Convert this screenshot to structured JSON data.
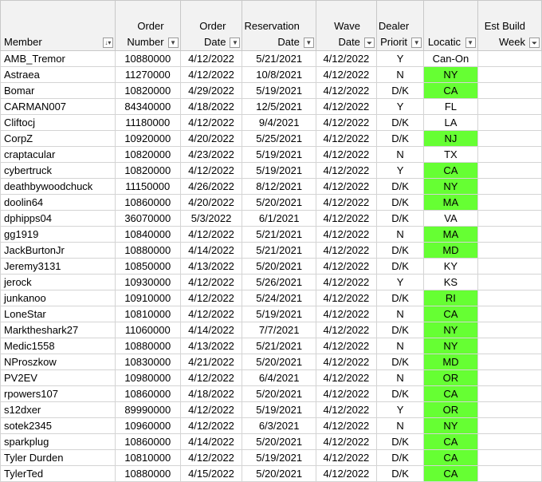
{
  "headers": {
    "member": [
      "Member"
    ],
    "order_number": [
      "Order",
      "Number"
    ],
    "order_date": [
      "Order",
      "Date"
    ],
    "reservation_date": [
      "Reservation",
      "Date"
    ],
    "wave_date": [
      "Wave",
      "Date"
    ],
    "dealer_priority": [
      "Dealer",
      "Priorit"
    ],
    "location": [
      "Locatic"
    ],
    "est_build_week": [
      "Est Build",
      "Week"
    ]
  },
  "filter_icons": {
    "member": "sort-ascending-icon",
    "order_number": "dropdown-arrow-icon",
    "order_date": "dropdown-arrow-icon",
    "reservation_date": "dropdown-arrow-icon",
    "wave_date": "filter-active-icon",
    "dealer_priority": "dropdown-arrow-icon",
    "location": "dropdown-arrow-icon",
    "est_build_week": "filter-active-icon"
  },
  "colors": {
    "location_highlight": "#66ff33",
    "header_bg": "#f2f2f2",
    "gridline": "#d4d4d4"
  },
  "rows": [
    {
      "member": "AMB_Tremor",
      "order_number": "10880000",
      "order_date": "4/12/2022",
      "reservation_date": "5/21/2021",
      "wave_date": "4/12/2022",
      "dealer_priority": "Y",
      "location": "Can-On",
      "highlight": false
    },
    {
      "member": "Astraea",
      "order_number": "11270000",
      "order_date": "4/12/2022",
      "reservation_date": "10/8/2021",
      "wave_date": "4/12/2022",
      "dealer_priority": "N",
      "location": "NY",
      "highlight": true
    },
    {
      "member": "Bomar",
      "order_number": "10820000",
      "order_date": "4/29/2022",
      "reservation_date": "5/19/2021",
      "wave_date": "4/12/2022",
      "dealer_priority": "D/K",
      "location": "CA",
      "highlight": true
    },
    {
      "member": "CARMAN007",
      "order_number": "84340000",
      "order_date": "4/18/2022",
      "reservation_date": "12/5/2021",
      "wave_date": "4/12/2022",
      "dealer_priority": "Y",
      "location": "FL",
      "highlight": false
    },
    {
      "member": "Cliftocj",
      "order_number": "11180000",
      "order_date": "4/12/2022",
      "reservation_date": "9/4/2021",
      "wave_date": "4/12/2022",
      "dealer_priority": "D/K",
      "location": "LA",
      "highlight": false
    },
    {
      "member": "CorpZ",
      "order_number": "10920000",
      "order_date": "4/20/2022",
      "reservation_date": "5/25/2021",
      "wave_date": "4/12/2022",
      "dealer_priority": "D/K",
      "location": "NJ",
      "highlight": true
    },
    {
      "member": "craptacular",
      "order_number": "10820000",
      "order_date": "4/23/2022",
      "reservation_date": "5/19/2021",
      "wave_date": "4/12/2022",
      "dealer_priority": "N",
      "location": "TX",
      "highlight": false
    },
    {
      "member": "cybertruck",
      "order_number": "10820000",
      "order_date": "4/12/2022",
      "reservation_date": "5/19/2021",
      "wave_date": "4/12/2022",
      "dealer_priority": "Y",
      "location": "CA",
      "highlight": true
    },
    {
      "member": "deathbywoodchuck",
      "order_number": "11150000",
      "order_date": "4/26/2022",
      "reservation_date": "8/12/2021",
      "wave_date": "4/12/2022",
      "dealer_priority": "D/K",
      "location": "NY",
      "highlight": true
    },
    {
      "member": "doolin64",
      "order_number": "10860000",
      "order_date": "4/20/2022",
      "reservation_date": "5/20/2021",
      "wave_date": "4/12/2022",
      "dealer_priority": "D/K",
      "location": "MA",
      "highlight": true
    },
    {
      "member": "dphipps04",
      "order_number": "36070000",
      "order_date": "5/3/2022",
      "reservation_date": "6/1/2021",
      "wave_date": "4/12/2022",
      "dealer_priority": "D/K",
      "location": "VA",
      "highlight": false
    },
    {
      "member": "gg1919",
      "order_number": "10840000",
      "order_date": "4/12/2022",
      "reservation_date": "5/21/2021",
      "wave_date": "4/12/2022",
      "dealer_priority": "N",
      "location": "MA",
      "highlight": true
    },
    {
      "member": "JackBurtonJr",
      "order_number": "10880000",
      "order_date": "4/14/2022",
      "reservation_date": "5/21/2021",
      "wave_date": "4/12/2022",
      "dealer_priority": "D/K",
      "location": "MD",
      "highlight": true
    },
    {
      "member": "Jeremy3131",
      "order_number": "10850000",
      "order_date": "4/13/2022",
      "reservation_date": "5/20/2021",
      "wave_date": "4/12/2022",
      "dealer_priority": "D/K",
      "location": "KY",
      "highlight": false
    },
    {
      "member": "jerock",
      "order_number": "10930000",
      "order_date": "4/12/2022",
      "reservation_date": "5/26/2021",
      "wave_date": "4/12/2022",
      "dealer_priority": "Y",
      "location": "KS",
      "highlight": false
    },
    {
      "member": "junkanoo",
      "order_number": "10910000",
      "order_date": "4/12/2022",
      "reservation_date": "5/24/2021",
      "wave_date": "4/12/2022",
      "dealer_priority": "D/K",
      "location": "RI",
      "highlight": true
    },
    {
      "member": "LoneStar",
      "order_number": "10810000",
      "order_date": "4/12/2022",
      "reservation_date": "5/19/2021",
      "wave_date": "4/12/2022",
      "dealer_priority": "N",
      "location": "CA",
      "highlight": true
    },
    {
      "member": "Marktheshark27",
      "order_number": "11060000",
      "order_date": "4/14/2022",
      "reservation_date": "7/7/2021",
      "wave_date": "4/12/2022",
      "dealer_priority": "D/K",
      "location": "NY",
      "highlight": true
    },
    {
      "member": "Medic1558",
      "order_number": "10880000",
      "order_date": "4/13/2022",
      "reservation_date": "5/21/2021",
      "wave_date": "4/12/2022",
      "dealer_priority": "N",
      "location": "NY",
      "highlight": true
    },
    {
      "member": "NProszkow",
      "order_number": "10830000",
      "order_date": "4/21/2022",
      "reservation_date": "5/20/2021",
      "wave_date": "4/12/2022",
      "dealer_priority": "D/K",
      "location": "MD",
      "highlight": true
    },
    {
      "member": "PV2EV",
      "order_number": "10980000",
      "order_date": "4/12/2022",
      "reservation_date": "6/4/2021",
      "wave_date": "4/12/2022",
      "dealer_priority": "N",
      "location": "OR",
      "highlight": true
    },
    {
      "member": "rpowers107",
      "order_number": "10860000",
      "order_date": "4/18/2022",
      "reservation_date": "5/20/2021",
      "wave_date": "4/12/2022",
      "dealer_priority": "D/K",
      "location": "CA",
      "highlight": true
    },
    {
      "member": "s12dxer",
      "order_number": "89990000",
      "order_date": "4/12/2022",
      "reservation_date": "5/19/2021",
      "wave_date": "4/12/2022",
      "dealer_priority": "Y",
      "location": "OR",
      "highlight": true
    },
    {
      "member": "sotek2345",
      "order_number": "10960000",
      "order_date": "4/12/2022",
      "reservation_date": "6/3/2021",
      "wave_date": "4/12/2022",
      "dealer_priority": "N",
      "location": "NY",
      "highlight": true
    },
    {
      "member": "sparkplug",
      "order_number": "10860000",
      "order_date": "4/14/2022",
      "reservation_date": "5/20/2021",
      "wave_date": "4/12/2022",
      "dealer_priority": "D/K",
      "location": "CA",
      "highlight": true
    },
    {
      "member": "Tyler Durden",
      "order_number": "10810000",
      "order_date": "4/12/2022",
      "reservation_date": "5/19/2021",
      "wave_date": "4/12/2022",
      "dealer_priority": "D/K",
      "location": "CA",
      "highlight": true
    },
    {
      "member": "TylerTed",
      "order_number": "10880000",
      "order_date": "4/15/2022",
      "reservation_date": "5/20/2021",
      "wave_date": "4/12/2022",
      "dealer_priority": "D/K",
      "location": "CA",
      "highlight": true
    }
  ]
}
